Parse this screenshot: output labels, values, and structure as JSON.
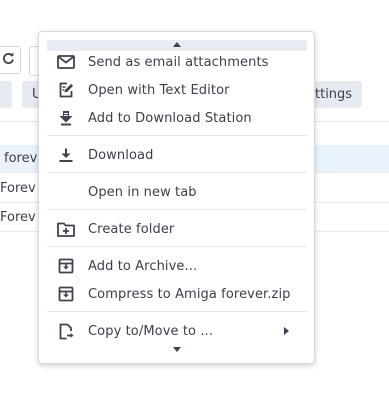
{
  "background": {
    "toolbar_button_1": "U",
    "toolbar_button_2": "ttings",
    "rows": [
      {
        "name": "forev"
      },
      {
        "name": "Forev"
      },
      {
        "name": "Forev"
      }
    ]
  },
  "context_menu": {
    "items": [
      {
        "label": "Send as email attachments",
        "icon": "mail-icon"
      },
      {
        "label": "Open with Text Editor",
        "icon": "edit-document-icon"
      },
      {
        "label": "Add to Download Station",
        "icon": "download-station-icon"
      },
      {
        "label": "Download",
        "icon": "download-icon"
      },
      {
        "label": "Open in new tab",
        "icon": ""
      },
      {
        "label": "Create folder",
        "icon": "add-folder-icon"
      },
      {
        "label": "Add to Archive...",
        "icon": "archive-icon"
      },
      {
        "label": "Compress to Amiga forever.zip",
        "icon": "compress-icon"
      },
      {
        "label": "Copy to/Move to ...",
        "icon": "copy-move-icon"
      }
    ]
  },
  "colors": {
    "icon": "#3e4350",
    "selected_row": "#e9f2fd",
    "menu_border": "#d5dae1"
  }
}
